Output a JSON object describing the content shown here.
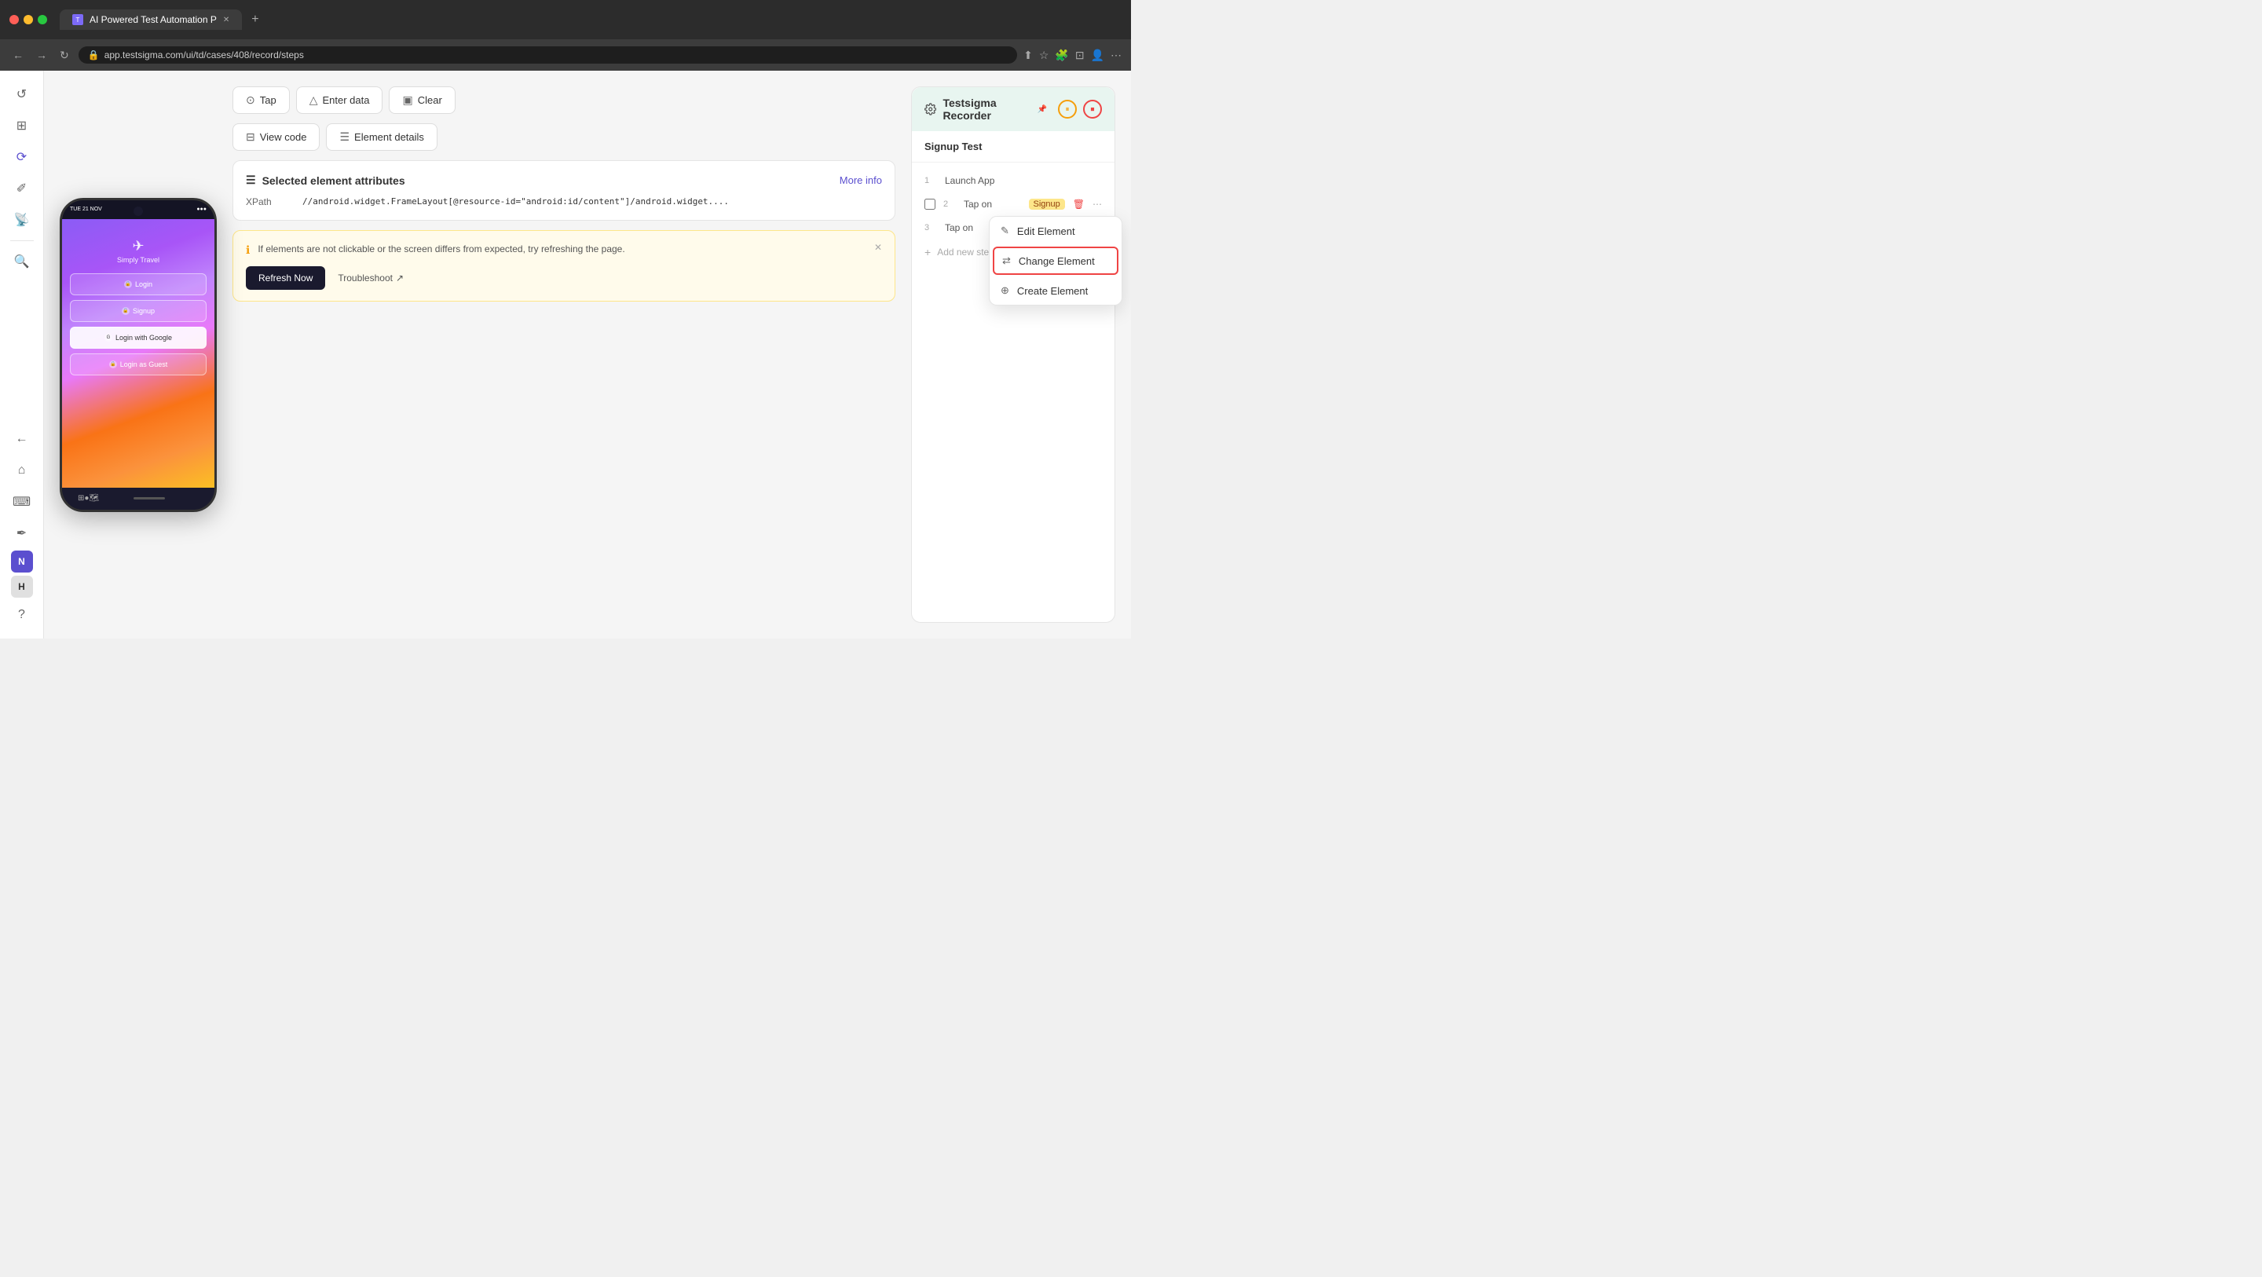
{
  "browser": {
    "tab_title": "AI Powered Test Automation P",
    "url": "app.testsigma.com/ui/td/cases/408/record/steps",
    "new_tab_label": "+"
  },
  "sidebar": {
    "icons": [
      "↺",
      "⊞",
      "⟳",
      "✎",
      "📡",
      "🔍"
    ],
    "bottom_items": [
      "N",
      "H",
      "?"
    ],
    "active": "⟳"
  },
  "action_buttons": {
    "row1": [
      {
        "label": "Tap",
        "icon": "⊙"
      },
      {
        "label": "Enter data",
        "icon": "△"
      },
      {
        "label": "Clear",
        "icon": "▣"
      }
    ],
    "row2": [
      {
        "label": "View code",
        "icon": "⊟"
      },
      {
        "label": "Element details",
        "icon": "☰"
      }
    ]
  },
  "element_attributes": {
    "title": "Selected element attributes",
    "more_info_label": "More info",
    "xpath_label": "XPath",
    "xpath_value": "//android.widget.FrameLayout[@resource-id=\"android:id/content\"]/android.widget...."
  },
  "info_box": {
    "message": "If elements are not clickable or the screen differs from expected, try refreshing the page.",
    "refresh_label": "Refresh Now",
    "troubleshoot_label": "Troubleshoot"
  },
  "recorder": {
    "title": "Testsigma Recorder",
    "test_name": "Signup Test",
    "steps": [
      {
        "number": "1",
        "text": "Launch App",
        "tag": null
      },
      {
        "number": "2",
        "text": "Tap on",
        "tag": "Signup"
      },
      {
        "number": "3",
        "text": "Tap on",
        "tag": null
      }
    ],
    "add_step_label": "Add new step"
  },
  "dropdown_menu": {
    "items": [
      {
        "label": "Edit Element",
        "icon": "✎"
      },
      {
        "label": "Change Element",
        "icon": "⇄",
        "highlighted": true
      },
      {
        "label": "Create Element",
        "icon": "⊕"
      }
    ]
  },
  "phone": {
    "brand": "Simply Travel",
    "buttons": [
      "Login",
      "Signup",
      "Login with Google",
      "Login as Guest"
    ],
    "time": "TUE 21 NOV",
    "status": "●●●"
  }
}
